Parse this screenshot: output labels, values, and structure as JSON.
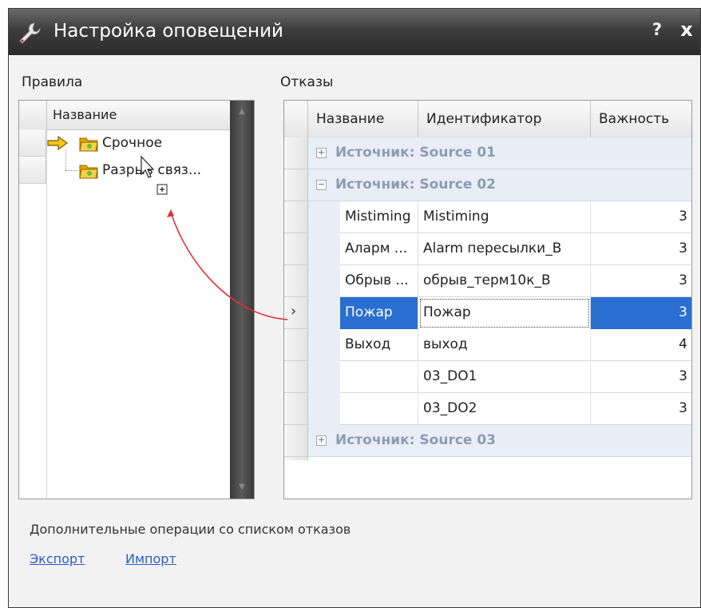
{
  "window": {
    "title": "Настройка оповещений",
    "help_label": "?",
    "close_label": "x"
  },
  "rules": {
    "section_label": "Правила",
    "column_header": "Название",
    "items": [
      {
        "label": "Срочное",
        "current": true
      },
      {
        "label": "Разрыв связ...",
        "current": false
      }
    ]
  },
  "failures": {
    "section_label": "Отказы",
    "columns": [
      "Название",
      "Идентификатор",
      "Важность"
    ],
    "groups": [
      {
        "label": "Источник: Source 01",
        "expand_glyph": "+"
      },
      {
        "label": "Источник: Source 02",
        "expand_glyph": "−"
      },
      {
        "label": "Источник: Source 03",
        "expand_glyph": "+"
      }
    ],
    "rows": [
      {
        "name": "Mistiming",
        "id": "Mistiming",
        "importance": "3"
      },
      {
        "name": "Аларм ...",
        "id": "Alarm пересылки_B",
        "importance": "3"
      },
      {
        "name": "Обрыв ...",
        "id": "обрыв_терм10к_B",
        "importance": "3"
      },
      {
        "name": "Пожар",
        "id": "Пожар",
        "importance": "3"
      },
      {
        "name": "Выход",
        "id": "выход",
        "importance": "4"
      },
      {
        "name": "",
        "id": "03_DO1",
        "importance": "3"
      },
      {
        "name": "",
        "id": "03_DO2",
        "importance": "3"
      }
    ],
    "selected_row_index": 3,
    "row_pointer_glyph": "›"
  },
  "footer": {
    "extra_label": "Дополнительные операции со списком отказов",
    "export_label": "Экспорт",
    "import_label": "Импорт"
  },
  "colors": {
    "selection": "#2a6fd1",
    "group_text": "#8b9cb5",
    "link": "#2a5fc0",
    "drag_arrow": "#e23030"
  },
  "icons": {
    "title": "wrench-icon",
    "current_rule": "arrow-right-icon",
    "rule": "folder-icon",
    "drop_cursor": "drag-copy-cursor-icon"
  }
}
